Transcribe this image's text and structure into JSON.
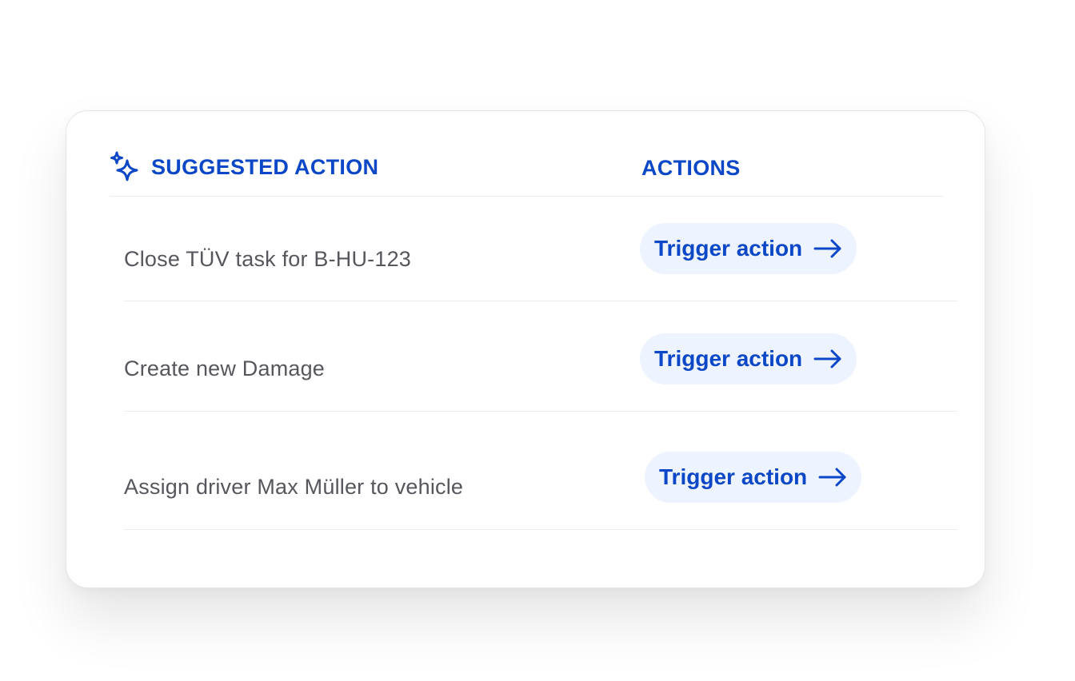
{
  "table": {
    "header": {
      "suggested_action": "SUGGESTED ACTION",
      "actions": "ACTIONS"
    },
    "rows": [
      {
        "label": "Close TÜV task for B-HU-123",
        "button": "Trigger action"
      },
      {
        "label": "Create new Damage",
        "button": "Trigger action"
      },
      {
        "label": "Assign driver Max Müller to vehicle",
        "button": "Trigger action"
      }
    ]
  },
  "colors": {
    "accent": "#0b47c6",
    "button_bg": "#eef4ff",
    "row_text": "#55575c",
    "divider": "#ebedf0"
  },
  "icons": {
    "header": "sparkle-icon",
    "button": "arrow-right-icon"
  }
}
